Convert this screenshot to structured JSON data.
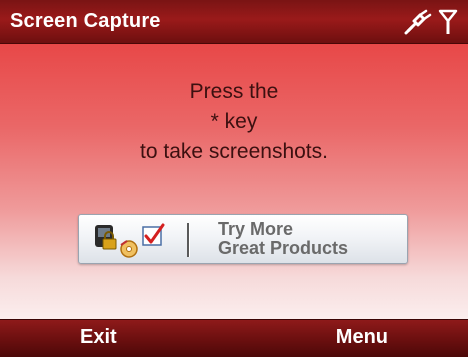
{
  "window": {
    "title": "Screen Capture",
    "status_icons": [
      "connection-icon",
      "signal-icon"
    ]
  },
  "message": {
    "line1": "Press the",
    "line2": "* key",
    "line3": "to take screenshots."
  },
  "promo": {
    "line1": "Try More",
    "line2": "Great Products",
    "icons": [
      "phone-lock-icon",
      "checkbox-icon",
      "disc-icon"
    ]
  },
  "softkeys": {
    "left": "Exit",
    "right": "Menu"
  },
  "colors": {
    "titlebar": "#9a1a1a",
    "content_top": "#e84848",
    "softkey_bar": "#6a0f0f",
    "message_text": "#3c1010",
    "promo_text": "#6a6a6a"
  }
}
